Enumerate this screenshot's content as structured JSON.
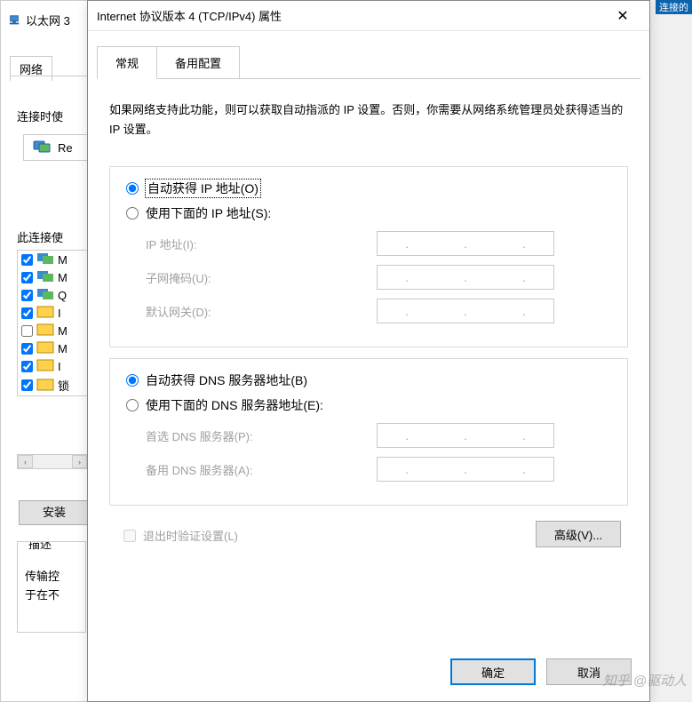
{
  "background": {
    "ethernet_label": "以太网 3",
    "tab_network": "网络",
    "connect_label": "连接时使",
    "re_item": "Re",
    "uses_label": "此连接使",
    "items": [
      {
        "checked": true,
        "text": "M"
      },
      {
        "checked": true,
        "text": "M"
      },
      {
        "checked": true,
        "text": "Q"
      },
      {
        "checked": true,
        "text": "I"
      },
      {
        "checked": false,
        "text": "M"
      },
      {
        "checked": true,
        "text": "M"
      },
      {
        "checked": true,
        "text": "I"
      },
      {
        "checked": true,
        "text": "锁"
      }
    ],
    "install_btn": "安装",
    "desc_legend": "描述",
    "desc_body": "传输控\n于在不"
  },
  "dialog": {
    "title": "Internet 协议版本 4 (TCP/IPv4) 属性",
    "tabs": {
      "general": "常规",
      "alt": "备用配置"
    },
    "desc": "如果网络支持此功能，则可以获取自动指派的 IP 设置。否则，你需要从网络系统管理员处获得适当的 IP 设置。",
    "ip": {
      "auto": "自动获得 IP 地址(O)",
      "manual": "使用下面的 IP 地址(S):",
      "addr_label": "IP 地址(I):",
      "mask_label": "子网掩码(U):",
      "gw_label": "默认网关(D):"
    },
    "dns": {
      "auto": "自动获得 DNS 服务器地址(B)",
      "manual": "使用下面的 DNS 服务器地址(E):",
      "pref_label": "首选 DNS 服务器(P):",
      "alt_label": "备用 DNS 服务器(A):"
    },
    "validate": "退出时验证设置(L)",
    "advanced": "高级(V)...",
    "ok": "确定",
    "cancel": "取消"
  },
  "watermark": "知乎 @驱动人",
  "topright": "连接的"
}
